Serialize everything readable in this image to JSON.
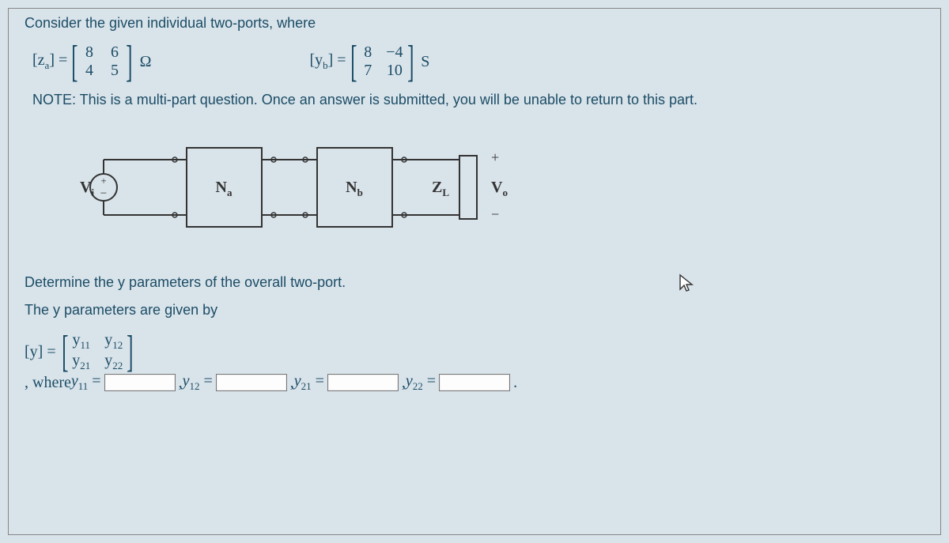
{
  "intro": "Consider the given individual two-ports, where",
  "za": {
    "label_left": "[z",
    "label_sub": "a",
    "eq": "] =",
    "m11": "8",
    "m12": "6",
    "m21": "4",
    "m22": "5",
    "unit": "Ω"
  },
  "yb": {
    "label_left": "[y",
    "label_sub": "b",
    "eq": "] =",
    "m11": "8",
    "m12": "−4",
    "m21": "7",
    "m22": "10",
    "unit": "S"
  },
  "note": "NOTE: This is a multi-part question. Once an answer is submitted, you will be unable to return to this part.",
  "circuit": {
    "Vi": "V",
    "Vi_sub": "i",
    "Na": "N",
    "Na_sub": "a",
    "Nb": "N",
    "Nb_sub": "b",
    "ZL": "Z",
    "ZL_sub": "L",
    "Vo": "V",
    "Vo_sub": "o",
    "plus": "+",
    "minus": "−",
    "src_plus": "+",
    "src_minus": "−"
  },
  "q1": "Determine the y parameters of the overall two-port.",
  "q2": "The y parameters are given by",
  "ymat": {
    "lhs": "[y] =",
    "y11": "y",
    "y11s": "11",
    "y12": "y",
    "y12s": "12",
    "y21": "y",
    "y21s": "21",
    "y22": "y",
    "y22s": "22"
  },
  "ans": {
    "where": ", where ",
    "l11a": "y",
    "l11b": "11",
    "l11c": " =",
    "l12a": "y",
    "l12b": "12",
    "l12c": " =",
    "l21a": "y",
    "l21b": "21",
    "l21c": " =",
    "l22a": "y",
    "l22b": "22",
    "l22c": " =",
    "sep": " , ",
    "period": "."
  }
}
